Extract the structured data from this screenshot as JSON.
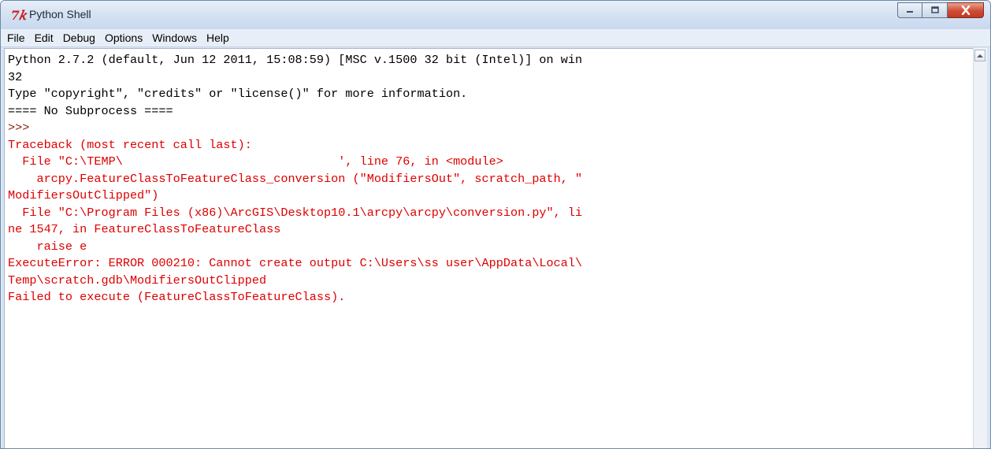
{
  "window": {
    "title": "Python Shell",
    "icon": "idle-python-icon"
  },
  "controls": {
    "minimize": "minimize-icon",
    "maximize": "maximize-icon",
    "close": "close-icon"
  },
  "menu": [
    "File",
    "Edit",
    "Debug",
    "Options",
    "Windows",
    "Help"
  ],
  "console": {
    "lines": [
      "Python 2.7.2 (default, Jun 12 2011, 15:08:59) [MSC v.1500 32 bit (Intel)] on win",
      "32",
      "Type \"copyright\", \"credits\" or \"license()\" for more information.",
      "==== No Subprocess ====",
      ">>> "
    ],
    "error_lines": [
      "Traceback (most recent call last):",
      "  File \"C:\\TEMP\\                              ', line 76, in <module>",
      "    arcpy.FeatureClassToFeatureClass_conversion (\"ModifiersOut\", scratch_path, \"",
      "ModifiersOutClipped\")",
      "  File \"C:\\Program Files (x86)\\ArcGIS\\Desktop10.1\\arcpy\\arcpy\\conversion.py\", li",
      "ne 1547, in FeatureClassToFeatureClass",
      "    raise e",
      "ExecuteError: ERROR 000210: Cannot create output C:\\Users\\ss user\\AppData\\Local\\",
      "Temp\\scratch.gdb\\ModifiersOutClipped",
      "Failed to execute (FeatureClassToFeatureClass)."
    ]
  },
  "colors": {
    "error_text": "#dd0000",
    "titlebar": "#d5e2f2",
    "close_button": "#cf4c33"
  }
}
